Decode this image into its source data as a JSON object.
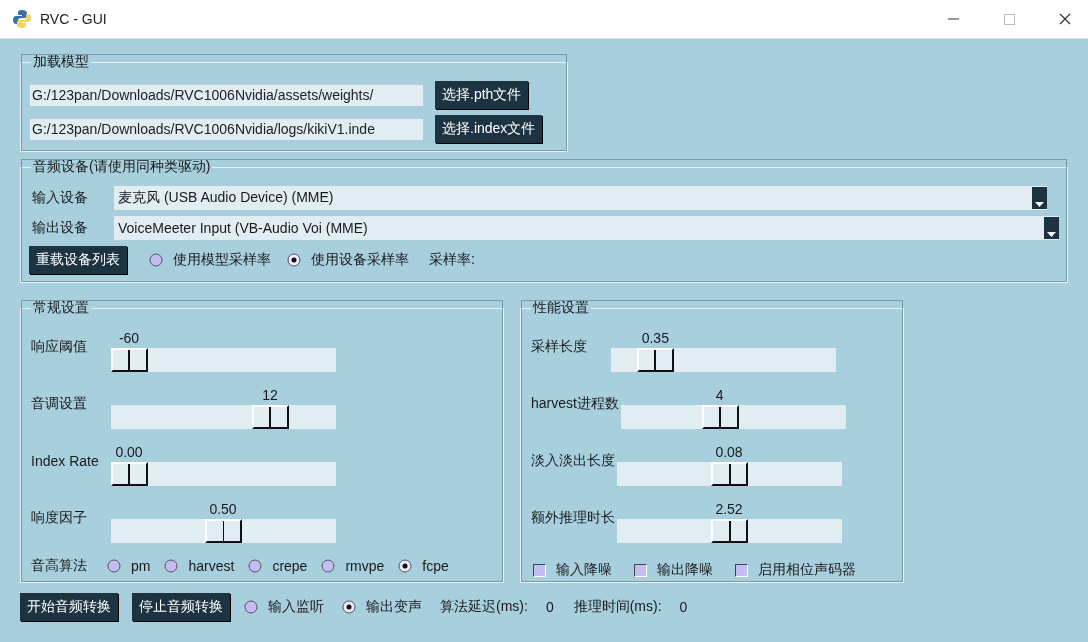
{
  "window": {
    "title": "RVC - GUI"
  },
  "load_model": {
    "title": "加载模型",
    "fields": [
      {
        "value": "G:/123pan/Downloads/RVC1006Nvidia/assets/weights/",
        "button": "选择.pth文件"
      },
      {
        "value": "G:/123pan/Downloads/RVC1006Nvidia/logs/kikiV1.inde",
        "button": "选择.index文件"
      }
    ]
  },
  "audio_devices": {
    "title": "音频设备(请使用同种类驱动)",
    "devices": [
      {
        "label": "输入设备",
        "value": "麦克风 (USB Audio Device) (MME)"
      },
      {
        "label": "输出设备",
        "value": "VoiceMeeter Input (VB-Audio Voi (MME)"
      }
    ],
    "reload_button": "重载设备列表",
    "sample_rate_options": [
      {
        "label": "使用模型采样率",
        "selected": false
      },
      {
        "label": "使用设备采样率",
        "selected": true
      }
    ],
    "sample_rate_label": "采样率:"
  },
  "general": {
    "title": "常规设置",
    "sliders": [
      {
        "label": "响应阈值",
        "reading": "-60",
        "level": 0
      },
      {
        "label": "音调设置",
        "reading": "12",
        "level": 0.75
      },
      {
        "label": "Index Rate",
        "reading": "0.00",
        "level": 0
      },
      {
        "label": "响度因子",
        "reading": "0.50",
        "level": 0.5
      }
    ],
    "pitch_algorithm": {
      "label": "音高算法",
      "options": [
        {
          "label": "pm",
          "selected": false
        },
        {
          "label": "harvest",
          "selected": false
        },
        {
          "label": "crepe",
          "selected": false
        },
        {
          "label": "rmvpe",
          "selected": false
        },
        {
          "label": "fcpe",
          "selected": true
        }
      ]
    }
  },
  "performance": {
    "title": "性能设置",
    "sliders": [
      {
        "label": "采样长度",
        "reading": "0.35",
        "level": 0.14
      },
      {
        "label": "harvest进程数",
        "reading": "4",
        "level": 0.43
      },
      {
        "label": "淡入淡出长度",
        "reading": "0.08",
        "level": 0.5
      },
      {
        "label": "额外推理时长",
        "reading": "2.52",
        "level": 0.5
      }
    ],
    "checkboxes": [
      {
        "label": "输入降噪",
        "checked": false
      },
      {
        "label": "输出降噪",
        "checked": false
      },
      {
        "label": "启用相位声码器",
        "checked": false
      }
    ]
  },
  "bottom": {
    "buttons": [
      "开始音频转换",
      "停止音频转换"
    ],
    "monitor_options": [
      {
        "label": "输入监听",
        "selected": false
      },
      {
        "label": "输出变声",
        "selected": true
      }
    ],
    "stats": [
      {
        "label": "算法延迟(ms):",
        "value": "0"
      },
      {
        "label": "推理时间(ms):",
        "value": "0"
      }
    ]
  }
}
